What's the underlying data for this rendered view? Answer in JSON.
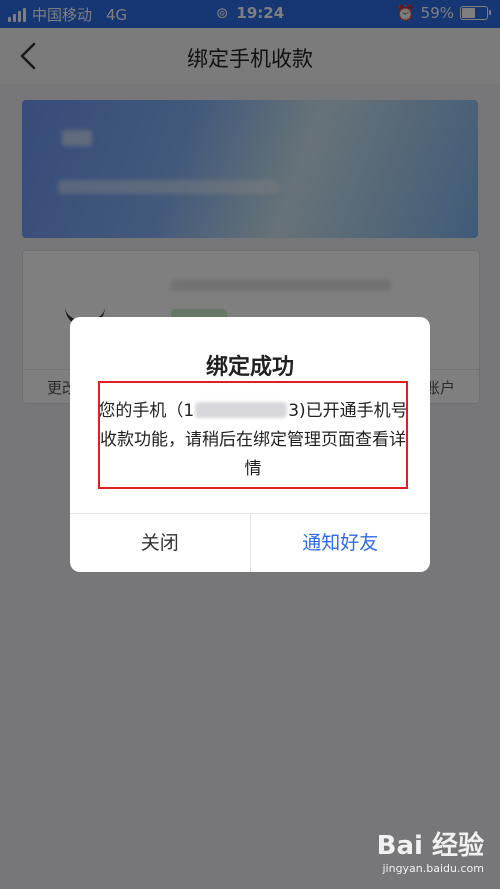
{
  "status_bar": {
    "carrier": "中国移动",
    "network": "4G",
    "time": "19:24",
    "battery": "59%",
    "battery_level": 0.59
  },
  "nav": {
    "title": "绑定手机收款"
  },
  "card": {
    "left_action": "更改",
    "right_action": "账户"
  },
  "dialog": {
    "title": "绑定成功",
    "message_prefix": "您的手机（1",
    "message_suffix": "3)已开通手机号收款功能，请稍后在绑定管理页面查看详情",
    "close_label": "关闭",
    "notify_label": "通知好友"
  },
  "watermark": {
    "logo": "Bai 经验",
    "url": "jingyan.baidu.com"
  },
  "colors": {
    "accent": "#2d6de8",
    "highlight": "#e02020"
  }
}
